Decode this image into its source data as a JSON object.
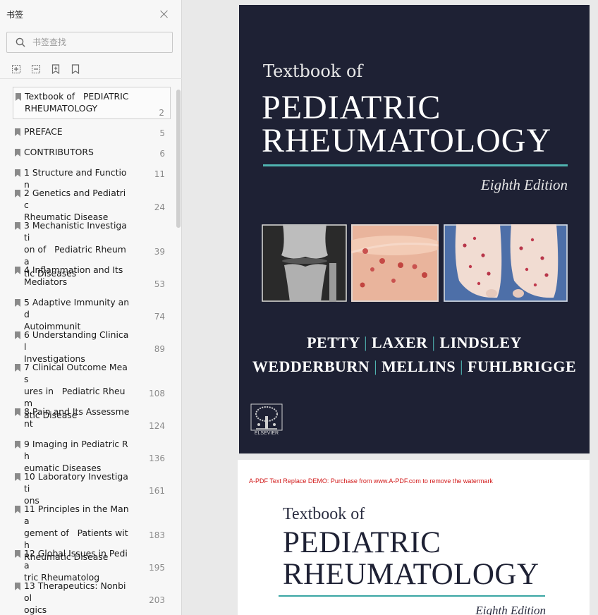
{
  "sidebar": {
    "title": "书签",
    "search_placeholder": "书签查找",
    "toolbar_icons": [
      "expand-all-icon",
      "collapse-all-icon",
      "add-bookmark-icon",
      "bookmark-outline-icon"
    ],
    "bookmarks": [
      {
        "label": "Textbook of   PEDIATRIC\nRHEUMATOLOGY",
        "page": "2",
        "selected": true
      },
      {
        "label": "PREFACE",
        "page": "5"
      },
      {
        "label": "CONTRIBUTORS",
        "page": "6"
      },
      {
        "label": "1 Structure and Function",
        "page": "11"
      },
      {
        "label": "2 Genetics and Pediatric\nRheumatic Disease",
        "page": "24"
      },
      {
        "label": "3 Mechanistic Investigati\non of   Pediatric Rheuma\ntic Diseases",
        "page": "39"
      },
      {
        "label": "4 Inflammation and Its\nMediators",
        "page": "53"
      },
      {
        "label": "5 Adaptive Immunity and\nAutoimmunit",
        "page": "74"
      },
      {
        "label": "6 Understanding Clinical\nInvestigations",
        "page": "89"
      },
      {
        "label": "7 Clinical Outcome Meas\nures in   Pediatric Rheum\natic Disease",
        "page": "108"
      },
      {
        "label": "8 Pain and Its Assessme\nnt",
        "page": "124"
      },
      {
        "label": "9 Imaging in Pediatric Rh\neumatic Diseases",
        "page": "136"
      },
      {
        "label": "10 Laboratory Investigati\nons",
        "page": "161"
      },
      {
        "label": "11 Principles in the Mana\ngement of   Patients with\nRheumatic Disease",
        "page": "183"
      },
      {
        "label": "12 Global Issues in Pedia\ntric Rheumatolog",
        "page": "195"
      },
      {
        "label": "13 Therapeutics: Nonbiol\nogics",
        "page": "203"
      }
    ]
  },
  "cover": {
    "textbook_of": "Textbook of",
    "title_line1": "PEDIATRIC",
    "title_line2": "RHEUMATOLOGY",
    "edition": "Eighth Edition",
    "authors_line1": [
      "PETTY",
      "LAXER",
      "LINDSLEY"
    ],
    "authors_line2": [
      "WEDDERBURN",
      "MELLINS",
      "FUHLBRIGGE"
    ],
    "separator": "|",
    "publisher": "ELSEVIER",
    "accent_color": "#4fb3b0",
    "background_color": "#1e2134"
  },
  "page2": {
    "watermark": "A-PDF Text Replace DEMO: Purchase from www.A-PDF.com to remove the watermark",
    "textbook_of": "Textbook of",
    "title_line1": "PEDIATRIC",
    "title_line2": "RHEUMATOLOGY",
    "edition": "Eighth Edition"
  }
}
